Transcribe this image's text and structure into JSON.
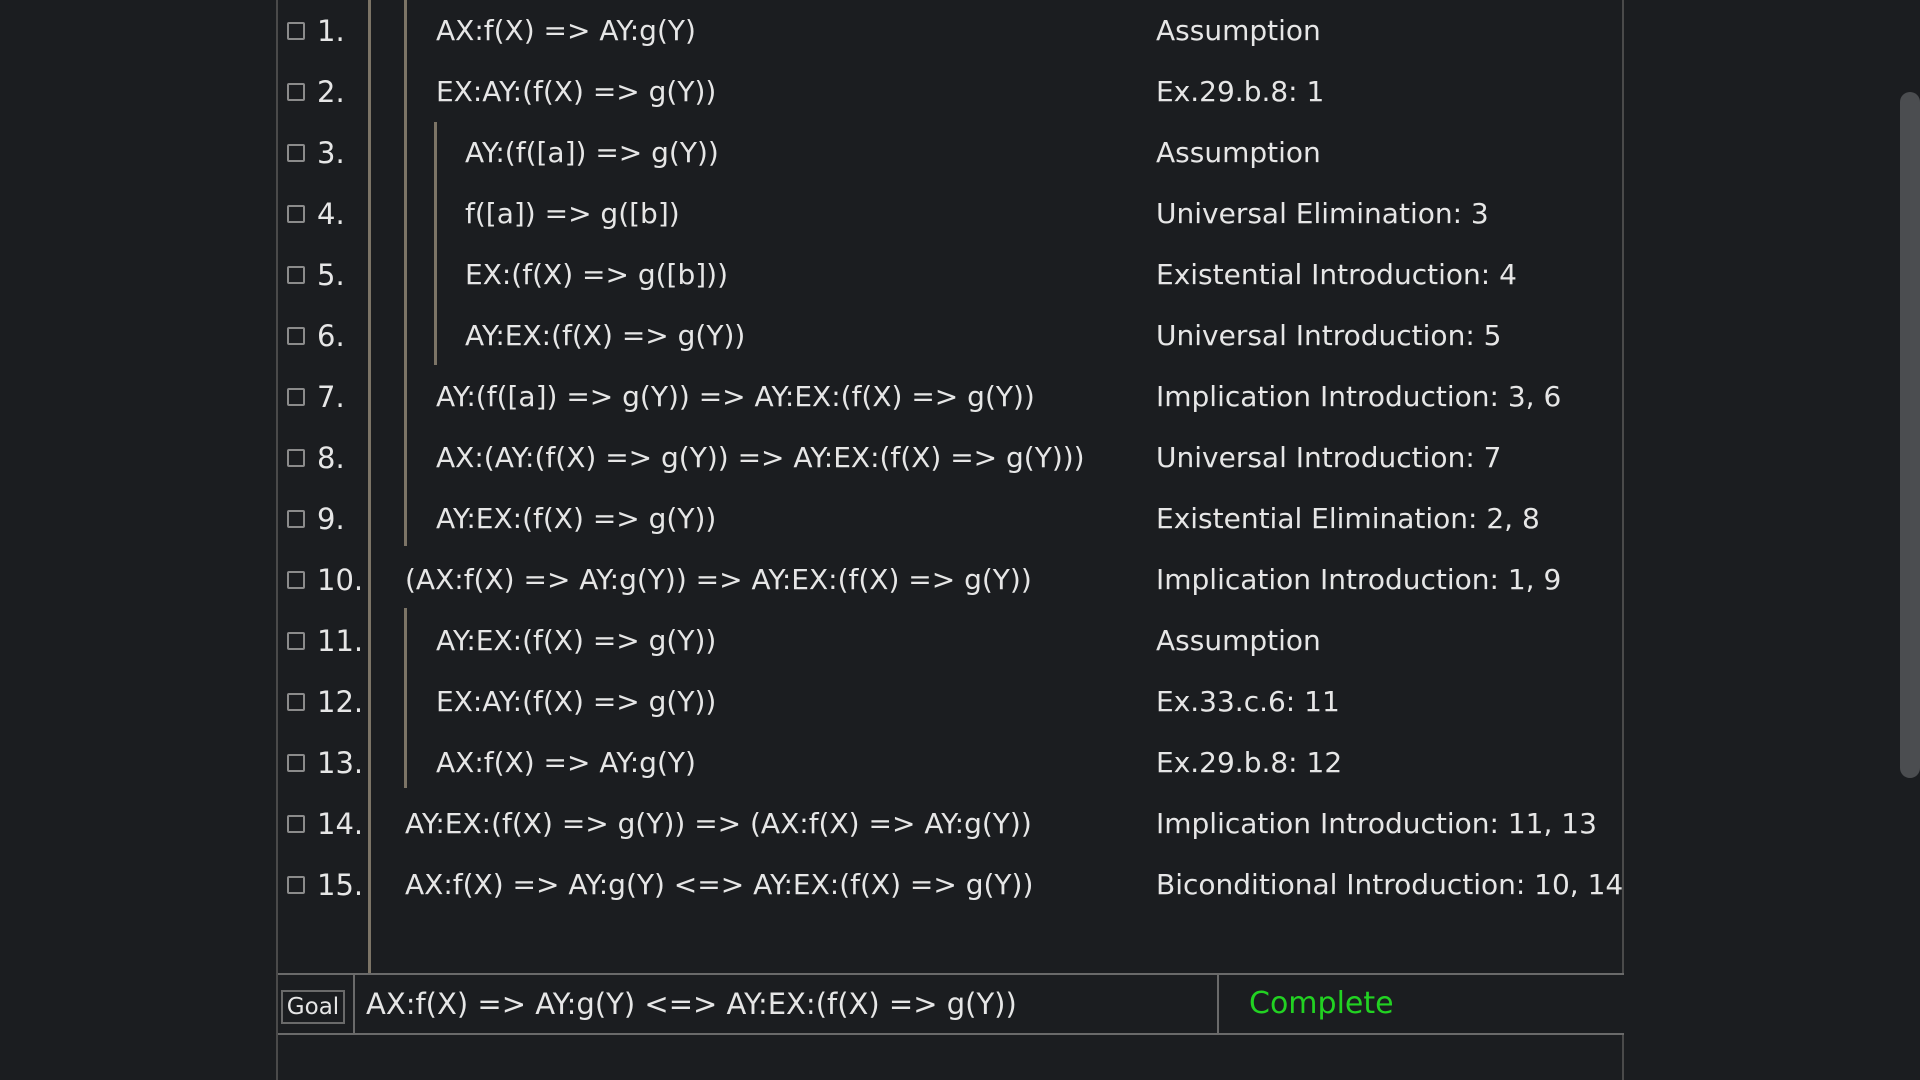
{
  "proof": {
    "lines": [
      {
        "num": "1.",
        "formula": "AX:f(X) => AY:g(Y)",
        "justification": "Assumption"
      },
      {
        "num": "2.",
        "formula": "EX:AY:(f(X) => g(Y))",
        "justification": "Ex.29.b.8: 1"
      },
      {
        "num": "3.",
        "formula": "AY:(f([a]) => g(Y))",
        "justification": "Assumption"
      },
      {
        "num": "4.",
        "formula": "f([a]) => g([b])",
        "justification": "Universal Elimination: 3"
      },
      {
        "num": "5.",
        "formula": "EX:(f(X) => g([b]))",
        "justification": "Existential Introduction: 4"
      },
      {
        "num": "6.",
        "formula": "AY:EX:(f(X) => g(Y))",
        "justification": "Universal Introduction: 5"
      },
      {
        "num": "7.",
        "formula": "AY:(f([a]) => g(Y)) => AY:EX:(f(X) => g(Y))",
        "justification": "Implication Introduction: 3, 6"
      },
      {
        "num": "8.",
        "formula": "AX:(AY:(f(X) => g(Y)) => AY:EX:(f(X) => g(Y)))",
        "justification": "Universal Introduction: 7"
      },
      {
        "num": "9.",
        "formula": "AY:EX:(f(X) => g(Y))",
        "justification": "Existential Elimination: 2, 8"
      },
      {
        "num": "10.",
        "formula": "(AX:f(X) => AY:g(Y)) => AY:EX:(f(X) => g(Y))",
        "justification": "Implication Introduction: 1, 9"
      },
      {
        "num": "11.",
        "formula": "AY:EX:(f(X) => g(Y))",
        "justification": "Assumption"
      },
      {
        "num": "12.",
        "formula": "EX:AY:(f(X) => g(Y))",
        "justification": "Ex.33.c.6: 11"
      },
      {
        "num": "13.",
        "formula": "AX:f(X) => AY:g(Y)",
        "justification": "Ex.29.b.8: 12"
      },
      {
        "num": "14.",
        "formula": "AY:EX:(f(X) => g(Y)) => (AX:f(X) => AY:g(Y))",
        "justification": "Implication Introduction: 11, 13"
      },
      {
        "num": "15.",
        "formula": "AX:f(X) => AY:g(Y) <=> AY:EX:(f(X) => g(Y))",
        "justification": "Biconditional Introduction: 10, 14"
      }
    ]
  },
  "goal": {
    "label": "Goal",
    "formula": "AX:f(X) => AY:g(Y) <=> AY:EX:(f(X) => g(Y))",
    "status": "Complete",
    "status_color": "#22d222"
  }
}
